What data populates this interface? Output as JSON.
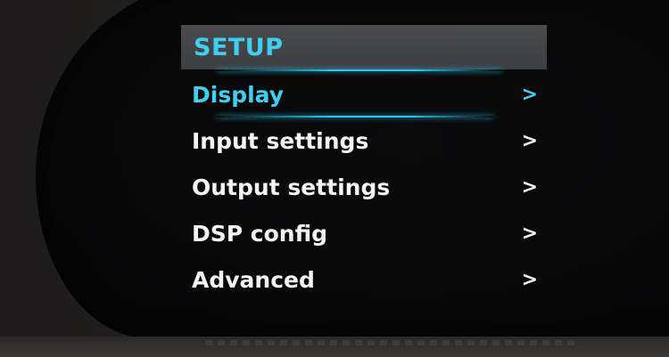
{
  "menu": {
    "title": "SETUP",
    "items": [
      {
        "label": "Display",
        "chevron": ">"
      },
      {
        "label": "Input settings",
        "chevron": ">"
      },
      {
        "label": "Output settings",
        "chevron": ">"
      },
      {
        "label": "DSP config",
        "chevron": ">"
      },
      {
        "label": "Advanced",
        "chevron": ">"
      }
    ],
    "selected_index": 0
  },
  "colors": {
    "accent": "#3fd0f0",
    "text": "#f4f4f4",
    "title_bar": "#45464a",
    "screen_bg": "#070708"
  }
}
